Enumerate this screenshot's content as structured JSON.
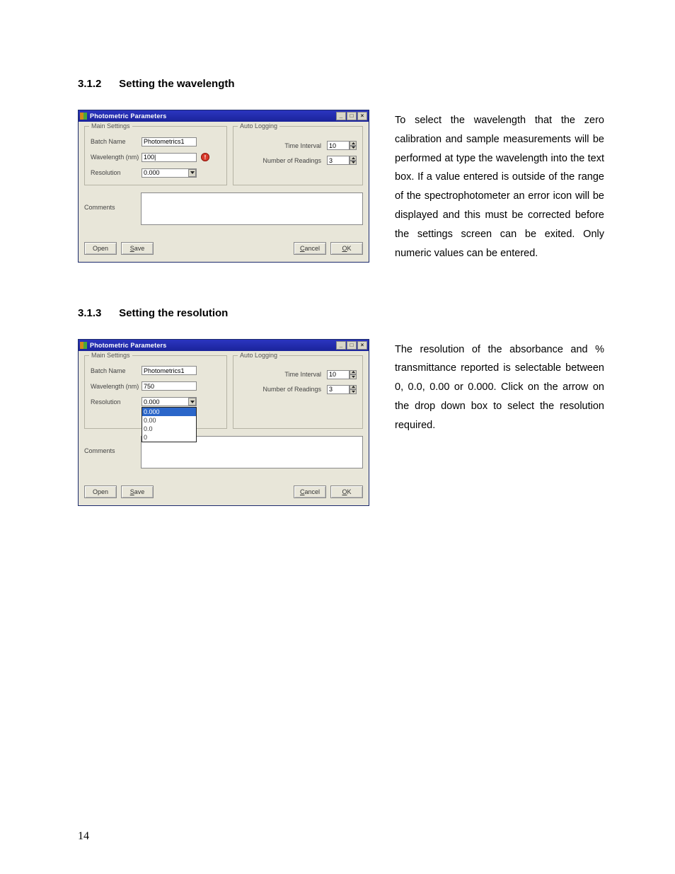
{
  "sections": {
    "s1": {
      "num": "3.1.2",
      "title": "Setting the wavelength",
      "desc": "To select the wavelength that the zero calibration and sample measurements will be performed at type the wavelength into the text box. If a value entered is outside of the range of the spectrophotometer an error icon will be displayed and this must be corrected before the settings screen can be exited. Only numeric values can be entered."
    },
    "s2": {
      "num": "3.1.3",
      "title": "Setting the resolution",
      "desc": "The resolution of the absorbance and % transmittance reported is selectable between 0, 0.0, 0.00 or 0.000. Click on the arrow on the drop down box to select the resolution required."
    }
  },
  "dialog": {
    "title": "Photometric Parameters",
    "group_main": "Main Settings",
    "group_auto": "Auto Logging",
    "labels": {
      "batch": "Batch Name",
      "wavelength": "Wavelength (nm)",
      "resolution": "Resolution",
      "comments": "Comments",
      "time_interval": "Time Interval",
      "num_readings": "Number of Readings"
    },
    "buttons": {
      "open": "Open",
      "save": "ave",
      "save_mn": "S",
      "cancel": "ancel",
      "cancel_mn": "C",
      "ok": "K",
      "ok_mn": "O"
    },
    "resolution_options": [
      "0.000",
      "0.00",
      "0.0",
      "0"
    ]
  },
  "dialog1": {
    "batch_value": "Photometrics1",
    "wavelength_value": "100|",
    "resolution_value": "0.000",
    "time_interval_value": "10",
    "num_readings_value": "3",
    "show_error_icon": true
  },
  "dialog2": {
    "batch_value": "Photometrics1",
    "wavelength_value": "750",
    "resolution_value": "0.000",
    "time_interval_value": "10",
    "num_readings_value": "3",
    "resolution_dropdown_open": true,
    "resolution_selected": "0.000"
  },
  "page_number": "14"
}
